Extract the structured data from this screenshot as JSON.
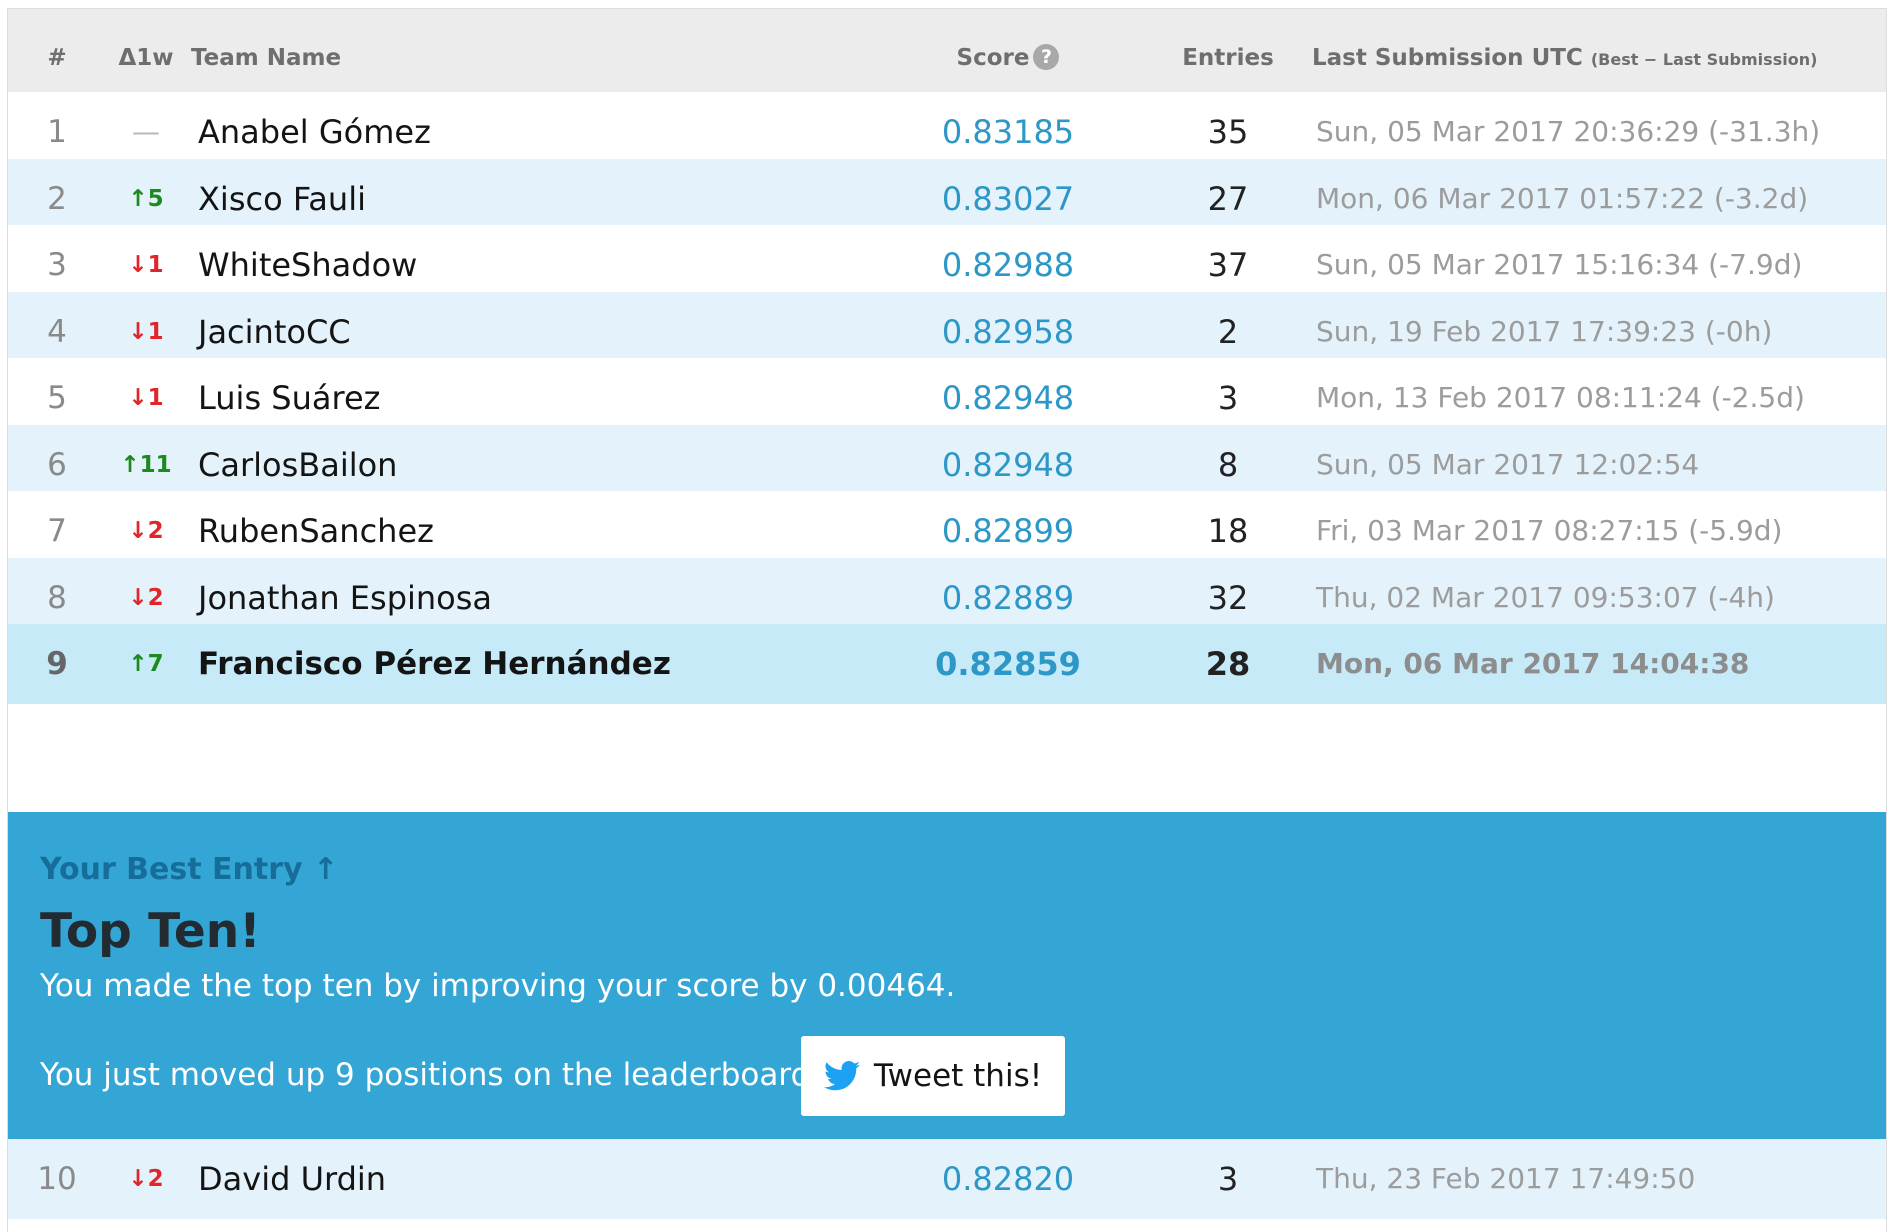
{
  "header": {
    "rank": "#",
    "delta": "Δ1w",
    "team": "Team Name",
    "score": "Score",
    "help_glyph": "?",
    "entries": "Entries",
    "last": "Last Submission UTC",
    "last_note": "(Best − Last Submission)"
  },
  "rows": [
    {
      "rank": "1",
      "delta": "—",
      "team": "Anabel Gómez",
      "score": "0.83185",
      "entries": "35",
      "last": "Sun, 05 Mar 2017 20:36:29 (-31.3h)"
    },
    {
      "rank": "2",
      "delta": "↑5",
      "team": "Xisco Fauli",
      "score": "0.83027",
      "entries": "27",
      "last": "Mon, 06 Mar 2017 01:57:22 (-3.2d)"
    },
    {
      "rank": "3",
      "delta": "↓1",
      "team": "WhiteShadow",
      "score": "0.82988",
      "entries": "37",
      "last": "Sun, 05 Mar 2017 15:16:34 (-7.9d)"
    },
    {
      "rank": "4",
      "delta": "↓1",
      "team": "JacintoCC",
      "score": "0.82958",
      "entries": "2",
      "last": "Sun, 19 Feb 2017 17:39:23 (-0h)"
    },
    {
      "rank": "5",
      "delta": "↓1",
      "team": "Luis Suárez",
      "score": "0.82948",
      "entries": "3",
      "last": "Mon, 13 Feb 2017 08:11:24 (-2.5d)"
    },
    {
      "rank": "6",
      "delta": "↑11",
      "team": "CarlosBailon",
      "score": "0.82948",
      "entries": "8",
      "last": "Sun, 05 Mar 2017 12:02:54"
    },
    {
      "rank": "7",
      "delta": "↓2",
      "team": "RubenSanchez",
      "score": "0.82899",
      "entries": "18",
      "last": "Fri, 03 Mar 2017 08:27:15 (-5.9d)"
    },
    {
      "rank": "8",
      "delta": "↓2",
      "team": "Jonathan Espinosa",
      "score": "0.82889",
      "entries": "32",
      "last": "Thu, 02 Mar 2017 09:53:07 (-4h)"
    },
    {
      "rank": "9",
      "delta": "↑7",
      "team": "Francisco Pérez Hernández",
      "score": "0.82859",
      "entries": "28",
      "last": "Mon, 06 Mar 2017 14:04:38"
    },
    {
      "rank": "10",
      "delta": "↓2",
      "team": "David Urdin",
      "score": "0.82820",
      "entries": "3",
      "last": "Thu, 23 Feb 2017 17:49:50"
    }
  ],
  "promo": {
    "kicker": "Your Best Entry ↑",
    "title": "Top Ten!",
    "line1": "You made the top ten by improving your score by 0.00464.",
    "line2": "You just moved up 9 positions on the leaderboard.",
    "tweet_label": "Tweet this!",
    "tweet_icon": "twitter-bird-icon"
  },
  "colors": {
    "header_bg": "#ececec",
    "row_alt_bg": "#e4f3fb",
    "row_self_bg": "#c6eaf8",
    "promo_bg": "#33a6d6",
    "score_text": "#2d97c7",
    "delta_up": "#1d8a1d",
    "delta_down": "#e0262b"
  }
}
